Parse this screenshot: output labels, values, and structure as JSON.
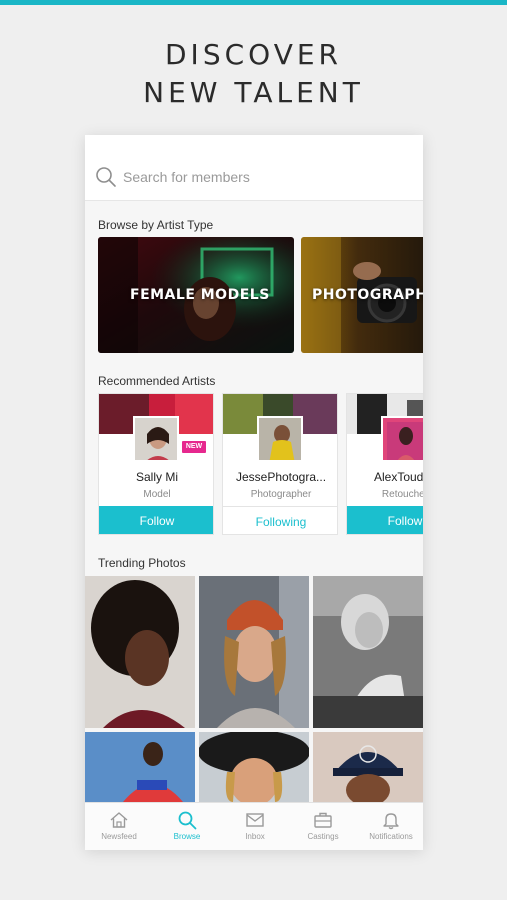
{
  "headline": {
    "line1": "DISCOVER",
    "line2": "NEW TALENT"
  },
  "search": {
    "placeholder": "Search for members"
  },
  "browse": {
    "title": "Browse by Artist Type",
    "cards": [
      {
        "label": "FEMALE MODELS"
      },
      {
        "label": "PHOTOGRAPHERS"
      }
    ]
  },
  "recommended": {
    "title": "Recommended Artists",
    "artists": [
      {
        "name": "Sally Mi",
        "role": "Model",
        "action": "Follow",
        "badge": "NEW"
      },
      {
        "name": "JessePhotogra...",
        "role": "Photographer",
        "action": "Following"
      },
      {
        "name": "AlexToudes",
        "role": "Retoucher",
        "action": "Follow"
      }
    ]
  },
  "trending": {
    "title": "Trending Photos"
  },
  "tabs": [
    {
      "label": "Newsfeed",
      "icon": "home-icon"
    },
    {
      "label": "Browse",
      "icon": "search-icon",
      "active": true
    },
    {
      "label": "Inbox",
      "icon": "mail-icon"
    },
    {
      "label": "Castings",
      "icon": "briefcase-icon"
    },
    {
      "label": "Notifications",
      "icon": "bell-icon"
    }
  ],
  "colors": {
    "accent": "#1bbfce",
    "badge": "#e6288e",
    "topbar": "#1ab6c6"
  }
}
